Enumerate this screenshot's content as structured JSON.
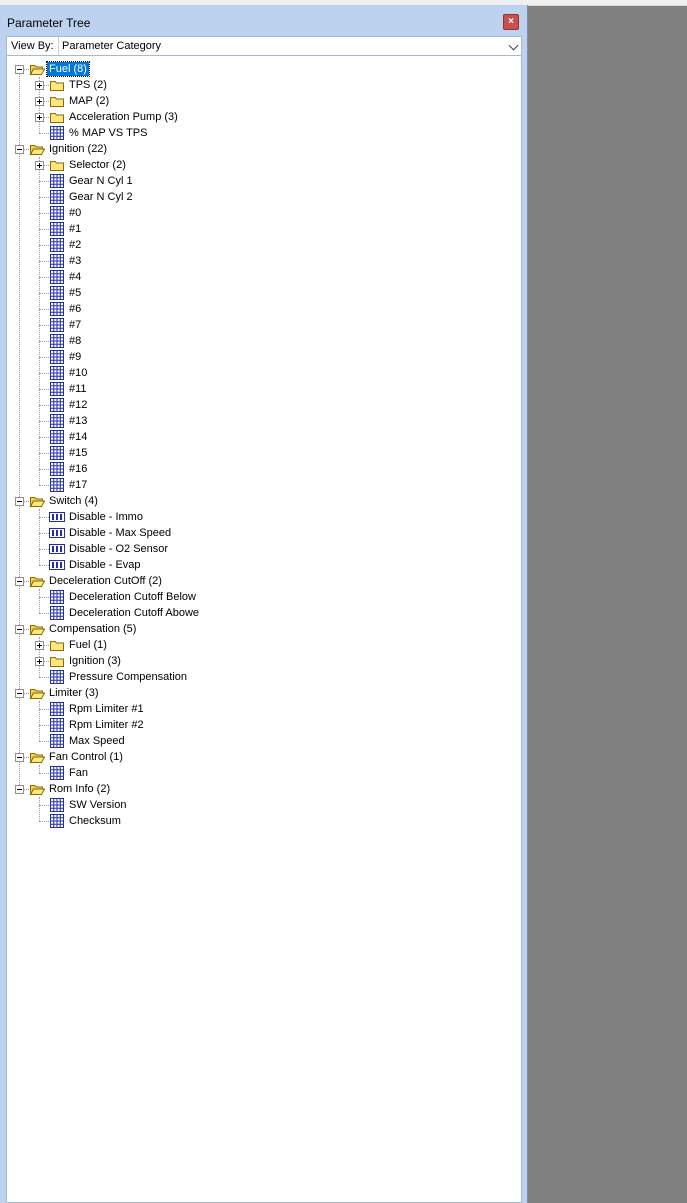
{
  "window": {
    "title": "Parameter Tree",
    "close_label": "×"
  },
  "viewby": {
    "label": "View By:",
    "selected": "Parameter Category"
  },
  "colors": {
    "selection": "#0078d7",
    "panel": "#bcd2ee",
    "folder_fill": "#ffe680",
    "folder_stroke": "#8a6d00",
    "table_grid": "#1f2fa8"
  },
  "tree": [
    {
      "label": "Fuel (8)",
      "level": 0,
      "icon": "folder-open",
      "expander": "expanded",
      "selected": true
    },
    {
      "label": "TPS (2)",
      "level": 1,
      "icon": "folder",
      "expander": "collapsed"
    },
    {
      "label": "MAP (2)",
      "level": 1,
      "icon": "folder",
      "expander": "collapsed"
    },
    {
      "label": "Acceleration Pump (3)",
      "level": 1,
      "icon": "folder",
      "expander": "collapsed"
    },
    {
      "label": "% MAP VS TPS",
      "level": 1,
      "icon": "table"
    },
    {
      "label": "Ignition (22)",
      "level": 0,
      "icon": "folder-open",
      "expander": "expanded"
    },
    {
      "label": "Selector (2)",
      "level": 1,
      "icon": "folder",
      "expander": "collapsed"
    },
    {
      "label": "Gear N Cyl 1",
      "level": 1,
      "icon": "table"
    },
    {
      "label": "Gear N Cyl 2",
      "level": 1,
      "icon": "table"
    },
    {
      "label": "#0",
      "level": 1,
      "icon": "table"
    },
    {
      "label": "#1",
      "level": 1,
      "icon": "table"
    },
    {
      "label": "#2",
      "level": 1,
      "icon": "table"
    },
    {
      "label": "#3",
      "level": 1,
      "icon": "table"
    },
    {
      "label": "#4",
      "level": 1,
      "icon": "table"
    },
    {
      "label": "#5",
      "level": 1,
      "icon": "table"
    },
    {
      "label": "#6",
      "level": 1,
      "icon": "table"
    },
    {
      "label": "#7",
      "level": 1,
      "icon": "table"
    },
    {
      "label": "#8",
      "level": 1,
      "icon": "table"
    },
    {
      "label": "#9",
      "level": 1,
      "icon": "table"
    },
    {
      "label": "#10",
      "level": 1,
      "icon": "table"
    },
    {
      "label": "#11",
      "level": 1,
      "icon": "table"
    },
    {
      "label": "#12",
      "level": 1,
      "icon": "table"
    },
    {
      "label": "#13",
      "level": 1,
      "icon": "table"
    },
    {
      "label": "#14",
      "level": 1,
      "icon": "table"
    },
    {
      "label": "#15",
      "level": 1,
      "icon": "table"
    },
    {
      "label": "#16",
      "level": 1,
      "icon": "table"
    },
    {
      "label": "#17",
      "level": 1,
      "icon": "table"
    },
    {
      "label": "Switch (4)",
      "level": 0,
      "icon": "folder-open",
      "expander": "expanded"
    },
    {
      "label": "Disable - Immo",
      "level": 1,
      "icon": "switch"
    },
    {
      "label": "Disable - Max Speed",
      "level": 1,
      "icon": "switch"
    },
    {
      "label": "Disable - O2 Sensor",
      "level": 1,
      "icon": "switch"
    },
    {
      "label": "Disable - Evap",
      "level": 1,
      "icon": "switch"
    },
    {
      "label": "Deceleration CutOff (2)",
      "level": 0,
      "icon": "folder-open",
      "expander": "expanded"
    },
    {
      "label": "Deceleration Cutoff Below",
      "level": 1,
      "icon": "table"
    },
    {
      "label": "Deceleration Cutoff Abowe",
      "level": 1,
      "icon": "table"
    },
    {
      "label": "Compensation (5)",
      "level": 0,
      "icon": "folder-open",
      "expander": "expanded"
    },
    {
      "label": "Fuel (1)",
      "level": 1,
      "icon": "folder",
      "expander": "collapsed"
    },
    {
      "label": "Ignition (3)",
      "level": 1,
      "icon": "folder",
      "expander": "collapsed"
    },
    {
      "label": "Pressure Compensation",
      "level": 1,
      "icon": "table"
    },
    {
      "label": "Limiter (3)",
      "level": 0,
      "icon": "folder-open",
      "expander": "expanded"
    },
    {
      "label": "Rpm Limiter #1",
      "level": 1,
      "icon": "table"
    },
    {
      "label": "Rpm Limiter #2",
      "level": 1,
      "icon": "table"
    },
    {
      "label": "Max Speed",
      "level": 1,
      "icon": "table"
    },
    {
      "label": "Fan Control (1)",
      "level": 0,
      "icon": "folder-open",
      "expander": "expanded"
    },
    {
      "label": "Fan",
      "level": 1,
      "icon": "table"
    },
    {
      "label": "Rom Info (2)",
      "level": 0,
      "icon": "folder-open",
      "expander": "expanded"
    },
    {
      "label": "SW Version",
      "level": 1,
      "icon": "table"
    },
    {
      "label": "Checksum",
      "level": 1,
      "icon": "table"
    }
  ]
}
